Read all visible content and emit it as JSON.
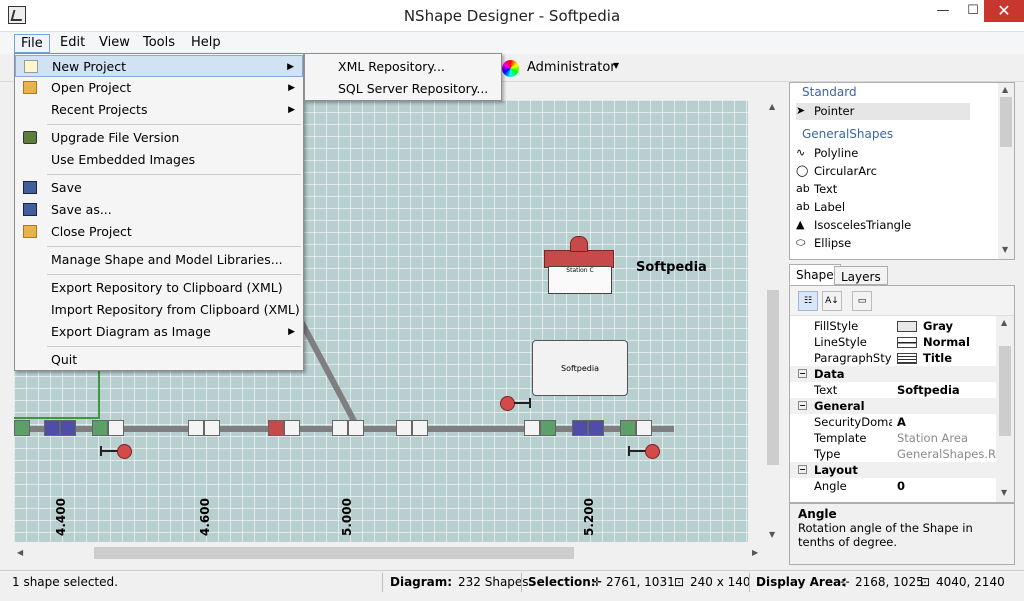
{
  "window": {
    "title": "NShape Designer - Softpedia",
    "minimize": "—",
    "maximize": "☐",
    "close": "✕"
  },
  "menubar": {
    "file": "File",
    "edit": "Edit",
    "view": "View",
    "tools": "Tools",
    "help": "Help"
  },
  "toolbar": {
    "user_role": "Administrator"
  },
  "file_menu": {
    "items": [
      {
        "label": "New Project",
        "has_submenu": true,
        "icon": "new-document-icon"
      },
      {
        "label": "Open Project",
        "has_submenu": true,
        "icon": "folder-open-icon"
      },
      {
        "label": "Recent Projects",
        "has_submenu": true
      },
      {
        "label": "Upgrade File Version",
        "icon": "upgrade-icon"
      },
      {
        "label": "Use Embedded Images"
      },
      {
        "label": "Save",
        "icon": "save-disk-icon"
      },
      {
        "label": "Save as...",
        "icon": "save-as-disk-icon"
      },
      {
        "label": "Close Project",
        "icon": "folder-close-icon"
      },
      {
        "label": "Manage Shape and Model Libraries..."
      },
      {
        "label": "Export Repository to Clipboard (XML)"
      },
      {
        "label": "Import Repository from Clipboard (XML)"
      },
      {
        "label": "Export Diagram as Image",
        "has_submenu": true
      },
      {
        "label": "Quit"
      }
    ]
  },
  "new_project_submenu": {
    "items": [
      {
        "label": "XML Repository..."
      },
      {
        "label": "SQL Server Repository..."
      }
    ]
  },
  "canvas": {
    "station_label": "Softpedia",
    "station_sign": "Station C",
    "box_label": "Softpedia",
    "axis_labels": [
      "4.400",
      "4.600",
      "5.000",
      "5.200"
    ]
  },
  "toolbox": {
    "categories": [
      {
        "name": "Standard",
        "items": [
          {
            "label": "Pointer",
            "icon": "pointer-arrow-icon"
          }
        ]
      },
      {
        "name": "GeneralShapes",
        "items": [
          {
            "label": "Polyline",
            "icon": "polyline-icon"
          },
          {
            "label": "CircularArc",
            "icon": "circular-arc-icon"
          },
          {
            "label": "Text",
            "icon": "text-ab-icon"
          },
          {
            "label": "Label",
            "icon": "label-ab-icon"
          },
          {
            "label": "IsoscelesTriangle",
            "icon": "triangle-icon"
          },
          {
            "label": "Ellipse",
            "icon": "ellipse-icon"
          }
        ]
      }
    ]
  },
  "tabs": {
    "shape": "Shape",
    "layers": "Layers"
  },
  "properties": {
    "rows": [
      {
        "kind": "prop",
        "name": "FillStyle",
        "value": "Gray",
        "bold": true,
        "swatch": "box"
      },
      {
        "kind": "prop",
        "name": "LineStyle",
        "value": "Normal",
        "bold": true,
        "swatch": "line"
      },
      {
        "kind": "prop",
        "name": "ParagraphStyle",
        "value": "Title",
        "bold": true,
        "swatch": "para"
      },
      {
        "kind": "cat",
        "name": "Data"
      },
      {
        "kind": "prop",
        "name": "Text",
        "value": "Softpedia",
        "bold": true
      },
      {
        "kind": "cat",
        "name": "General"
      },
      {
        "kind": "prop",
        "name": "SecurityDomainN",
        "value": "A",
        "bold": true
      },
      {
        "kind": "prop",
        "name": "Template",
        "value": "Station Area",
        "grey": true
      },
      {
        "kind": "prop",
        "name": "Type",
        "value": "GeneralShapes.Rou",
        "grey": true
      },
      {
        "kind": "cat",
        "name": "Layout"
      },
      {
        "kind": "prop",
        "name": "Angle",
        "value": "0",
        "bold": true
      }
    ]
  },
  "description": {
    "title": "Angle",
    "text": "Rotation angle of the Shape in tenths of degree."
  },
  "statusbar": {
    "selection_info": "1 shape selected.",
    "diagram_label": "Diagram:",
    "diagram_value": "232 Shapes",
    "selection_label": "Selection:",
    "selection_pos": "2761, 1031",
    "selection_size": "240 x 140",
    "display_label": "Display Area:",
    "display_pos": "2168, 1025",
    "display_size": "4040, 2140"
  },
  "colors": {
    "canvas": "#b8cfd0",
    "menu_highlight": "#d1e2f5",
    "category_text": "#3c64a6",
    "close_button": "#c7372f"
  }
}
